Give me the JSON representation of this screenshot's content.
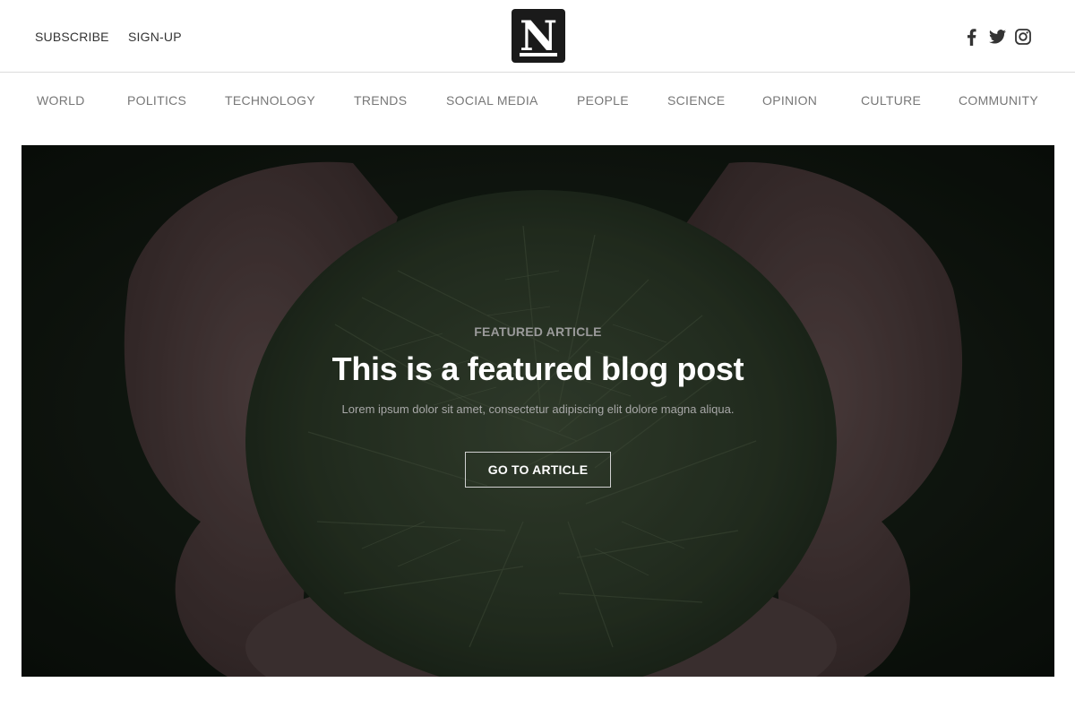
{
  "header": {
    "subscribe_label": "SUBSCRIBE",
    "signup_label": "SIGN-UP",
    "logo_letter": "N",
    "social": [
      {
        "name": "facebook-icon"
      },
      {
        "name": "twitter-icon"
      },
      {
        "name": "instagram-icon"
      }
    ]
  },
  "nav": {
    "categories": [
      {
        "label": "WORLD"
      },
      {
        "label": "POLITICS"
      },
      {
        "label": "TECHNOLOGY"
      },
      {
        "label": "TRENDS"
      },
      {
        "label": "SOCIAL MEDIA"
      },
      {
        "label": "PEOPLE"
      },
      {
        "label": "SCIENCE"
      },
      {
        "label": "OPINION"
      },
      {
        "label": "CULTURE"
      },
      {
        "label": "COMMUNITY"
      }
    ]
  },
  "hero": {
    "kicker": "FEATURED ARTICLE",
    "title": "This is a featured blog post",
    "description": "Lorem ipsum dolor sit amet, consectetur adipiscing elit dolore magna aliqua.",
    "button_label": "GO TO ARTICLE"
  },
  "colors": {
    "text_dark": "#333333",
    "nav_text": "#777777",
    "logo_bg": "#1a1a1a",
    "divider": "#dcdcdc"
  }
}
